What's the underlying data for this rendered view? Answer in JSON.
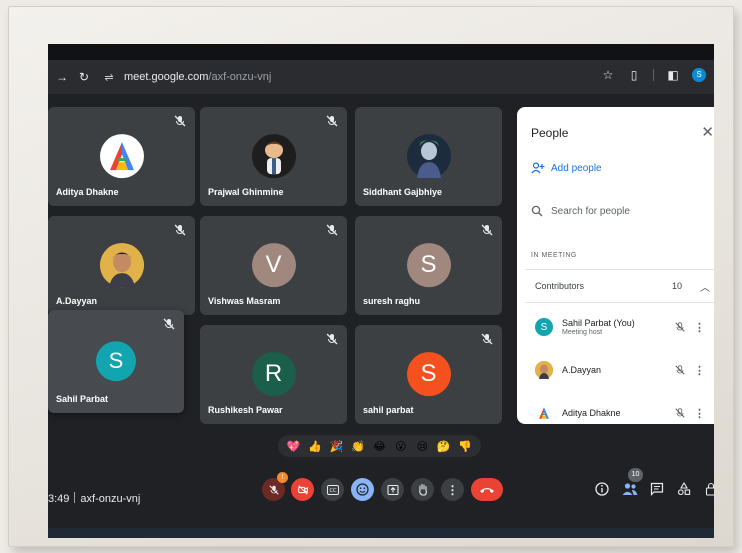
{
  "browser": {
    "url_host": "meet.google.com",
    "url_path": "/axf-onzu-vnj",
    "profile_initial": "S"
  },
  "tiles": [
    {
      "name": "Aditya Dhakne",
      "initial": "A",
      "color": "#ffffff"
    },
    {
      "name": "Prajwal Ghinmine",
      "initial": "",
      "color": "#2b2b2b"
    },
    {
      "name": "Siddhant Gajbhiye",
      "initial": "",
      "color": "#2c3e55"
    },
    {
      "name": "A.Dayyan",
      "initial": "",
      "color": "#d9a14a"
    },
    {
      "name": "Vishwas Masram",
      "initial": "V",
      "color": "#a1887f"
    },
    {
      "name": "suresh raghu",
      "initial": "S",
      "color": "#a1887f"
    },
    {
      "name": "Sahil Parbat",
      "initial": "S",
      "color": "#12a4af"
    },
    {
      "name": "Rushikesh Pawar",
      "initial": "R",
      "color": "#1b5e4a"
    },
    {
      "name": "sahil parbat",
      "initial": "S",
      "color": "#f4511e"
    }
  ],
  "panel": {
    "title": "People",
    "add_people": "Add people",
    "search_placeholder": "Search for people",
    "in_meeting": "IN MEETING",
    "contributors_label": "Contributors",
    "contributors_count": "10",
    "people": [
      {
        "name": "Sahil Parbat (You)",
        "sub": "Meeting host",
        "initial": "S",
        "color": "#12a4af"
      },
      {
        "name": "A.Dayyan",
        "sub": "",
        "initial": "",
        "color": "#d9a14a"
      },
      {
        "name": "Aditya Dhakne",
        "sub": "",
        "initial": "A",
        "color": "#ffffff"
      }
    ]
  },
  "reactions": [
    "💖",
    "👍",
    "🎉",
    "👏",
    "😂",
    "😮",
    "😢",
    "🤔",
    "👎"
  ],
  "bottom": {
    "time": "3:49",
    "meeting_code": "axf-onzu-vnj",
    "alert_badge": "!",
    "people_count": "10"
  }
}
